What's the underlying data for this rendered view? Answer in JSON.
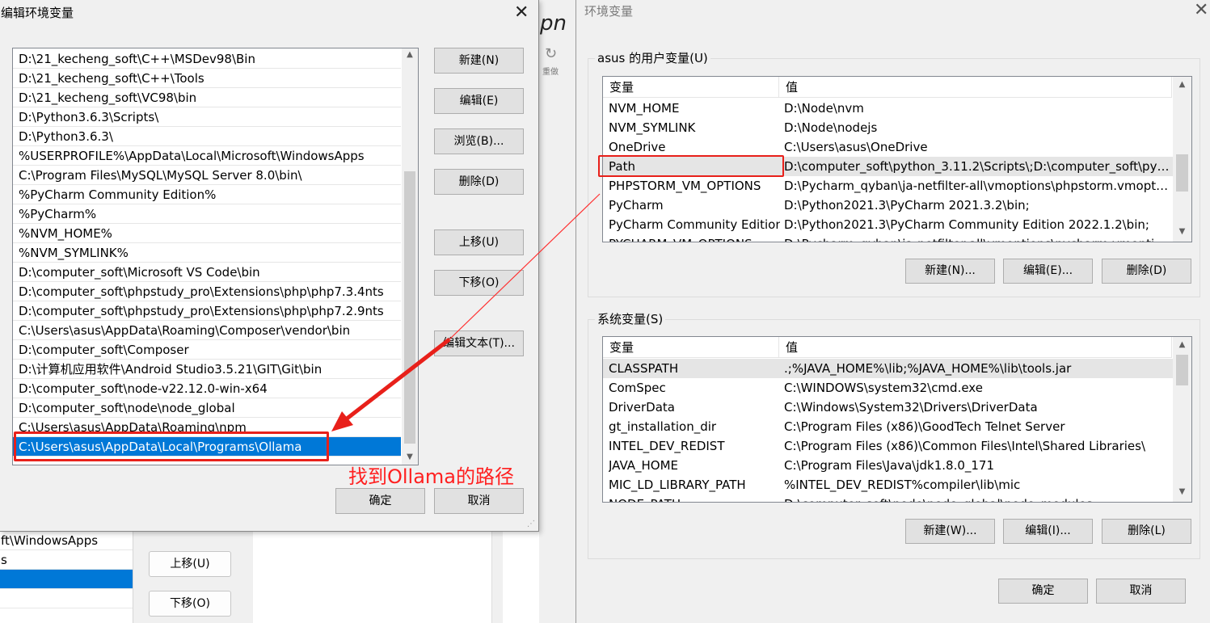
{
  "background": {
    "logo_text": "pn",
    "refresh_label": "重做",
    "list_items": [
      "ft\\WindowsApps",
      "s",
      "",
      ""
    ],
    "move_up": "上移(U)",
    "move_down": "下移(O)"
  },
  "edit_dialog": {
    "title": "编辑环境变量",
    "close": "✕",
    "paths": [
      "D:\\21_kecheng_soft\\C++\\MSDev98\\Bin",
      "D:\\21_kecheng_soft\\C++\\Tools",
      "D:\\21_kecheng_soft\\VC98\\bin",
      "D:\\Python3.6.3\\Scripts\\",
      "D:\\Python3.6.3\\",
      "%USERPROFILE%\\AppData\\Local\\Microsoft\\WindowsApps",
      "C:\\Program Files\\MySQL\\MySQL Server 8.0\\bin\\",
      "%PyCharm Community Edition%",
      "%PyCharm%",
      "%NVM_HOME%",
      "%NVM_SYMLINK%",
      "D:\\computer_soft\\Microsoft VS Code\\bin",
      "D:\\computer_soft\\phpstudy_pro\\Extensions\\php\\php7.3.4nts",
      "D:\\computer_soft\\phpstudy_pro\\Extensions\\php\\php7.2.9nts",
      "C:\\Users\\asus\\AppData\\Roaming\\Composer\\vendor\\bin",
      "D:\\computer_soft\\Composer",
      "D:\\计算机应用软件\\Android Studio3.5.21\\GIT\\Git\\bin",
      "D:\\computer_soft\\node-v22.12.0-win-x64",
      "D:\\computer_soft\\node\\node_global",
      "C:\\Users\\asus\\AppData\\Roaming\\npm",
      "C:\\Users\\asus\\AppData\\Local\\Programs\\Ollama"
    ],
    "selected_index": 20,
    "buttons": {
      "new": "新建(N)",
      "edit": "编辑(E)",
      "browse": "浏览(B)...",
      "delete": "删除(D)",
      "move_up": "上移(U)",
      "move_down": "下移(O)",
      "edit_text": "编辑文本(T)...",
      "ok": "确定",
      "cancel": "取消"
    },
    "annotation": "找到Ollama的路径"
  },
  "env_dialog": {
    "title": "环境变量",
    "close": "✕",
    "user_group_label": "asus 的用户变量(U)",
    "system_group_label": "系统变量(S)",
    "col_variable": "变量",
    "col_value": "值",
    "user_vars": [
      {
        "name": "NVM_HOME",
        "value": "D:\\Node\\nvm"
      },
      {
        "name": "NVM_SYMLINK",
        "value": "D:\\Node\\nodejs"
      },
      {
        "name": "OneDrive",
        "value": "C:\\Users\\asus\\OneDrive"
      },
      {
        "name": "Path",
        "value": "D:\\computer_soft\\python_3.11.2\\Scripts\\;D:\\computer_soft\\pyt..."
      },
      {
        "name": "PHPSTORM_VM_OPTIONS",
        "value": "D:\\Pycharm_qyban\\ja-netfilter-all\\vmoptions\\phpstorm.vmopti..."
      },
      {
        "name": "PyCharm",
        "value": "D:\\Python2021.3\\PyCharm 2021.3.2\\bin;"
      },
      {
        "name": "PyCharm Community Edition",
        "value": "D:\\Python2021.3\\PyCharm Community Edition 2022.1.2\\bin;"
      },
      {
        "name": "PYCHARM_VM_OPTIONS",
        "value": "D:\\Pycharm_qyban\\ja-netfilter-all\\vmoptions\\pycharm.vmoptio..."
      }
    ],
    "user_selected_index": 3,
    "user_buttons": {
      "new": "新建(N)...",
      "edit": "编辑(E)...",
      "delete": "删除(D)"
    },
    "system_vars": [
      {
        "name": "CLASSPATH",
        "value": ".;%JAVA_HOME%\\lib;%JAVA_HOME%\\lib\\tools.jar"
      },
      {
        "name": "ComSpec",
        "value": "C:\\WINDOWS\\system32\\cmd.exe"
      },
      {
        "name": "DriverData",
        "value": "C:\\Windows\\System32\\Drivers\\DriverData"
      },
      {
        "name": "gt_installation_dir",
        "value": "C:\\Program Files (x86)\\GoodTech Telnet Server"
      },
      {
        "name": "INTEL_DEV_REDIST",
        "value": "C:\\Program Files (x86)\\Common Files\\Intel\\Shared Libraries\\"
      },
      {
        "name": "JAVA_HOME",
        "value": "C:\\Program Files\\Java\\jdk1.8.0_171"
      },
      {
        "name": "MIC_LD_LIBRARY_PATH",
        "value": "%INTEL_DEV_REDIST%compiler\\lib\\mic"
      },
      {
        "name": "NODE_PATH",
        "value": "D:\\computer_soft\\node\\node_global\\node_modules"
      }
    ],
    "system_selected_index": 0,
    "system_buttons": {
      "new": "新建(W)...",
      "edit": "编辑(I)...",
      "delete": "删除(L)"
    },
    "ok": "确定",
    "cancel": "取消"
  },
  "colors": {
    "selection": "#0078d7",
    "annotation_red": "#ff2020",
    "dialog_bg": "#f0f0f0"
  }
}
